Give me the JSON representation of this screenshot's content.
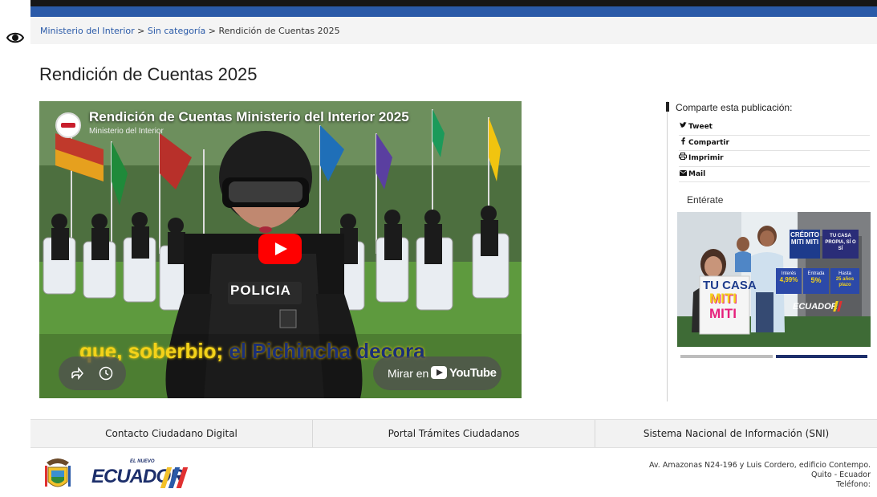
{
  "breadcrumb": {
    "home": "Ministerio del Interior",
    "sep1": ">",
    "category": "Sin categoría",
    "sep2": ">",
    "current": "Rendición de Cuentas 2025"
  },
  "page": {
    "title": "Rendición de Cuentas 2025"
  },
  "video": {
    "title": "Rendición de Cuentas Ministerio del Interior 2025",
    "channel": "Ministerio del Interior",
    "subtitle_highlight": "que, soberbio;",
    "subtitle_rest": " el Pichincha decora",
    "watch_label": "Mirar en",
    "youtube_word": "YouTube",
    "scene_text": "POLICIA"
  },
  "sidebar": {
    "share_heading": "Comparte esta publicación:",
    "share_items": [
      {
        "icon": "twitter-icon",
        "label": "Tweet"
      },
      {
        "icon": "facebook-icon",
        "label": "Compartir"
      },
      {
        "icon": "print-icon",
        "label": "Imprimir"
      },
      {
        "icon": "mail-icon",
        "label": "Mail"
      }
    ],
    "enterate": "Entérate",
    "promo": {
      "brand": "CRÉDITO MITI MITI",
      "slogan": "TU CASA PROPIA, SÍ O SÍ",
      "headline_1": "TU CASA",
      "headline_2": "MITI",
      "headline_3": "MITI",
      "rate_label": "Interés",
      "rate_value": "4,99%",
      "down_label": "Entrada",
      "down_value": "5%",
      "term_label": "Hasta",
      "term_value": "25 años plazo",
      "gov": "ECUADOR"
    },
    "carousel_active": 2,
    "carousel_total": 2
  },
  "footer": {
    "links": [
      "Contacto Ciudadano Digital",
      "Portal Trámites Ciudadanos",
      "Sistema Nacional de Información (SNI)"
    ],
    "logo_small": "EL NUEVO",
    "logo_main": "ECUADOR",
    "address_line1": "Av. Amazonas N24-196 y Luis Cordero, edificio Contempo.",
    "address_line2": "Quito - Ecuador",
    "address_line3": "Teléfono:"
  },
  "colors": {
    "top_bar": "#2a5aa8",
    "link": "#2a5aa8",
    "youtube_red": "#ff0000",
    "promo_yellow": "#f3d21a",
    "promo_blue": "#1d3b8c",
    "promo_pink": "#e6217c"
  }
}
